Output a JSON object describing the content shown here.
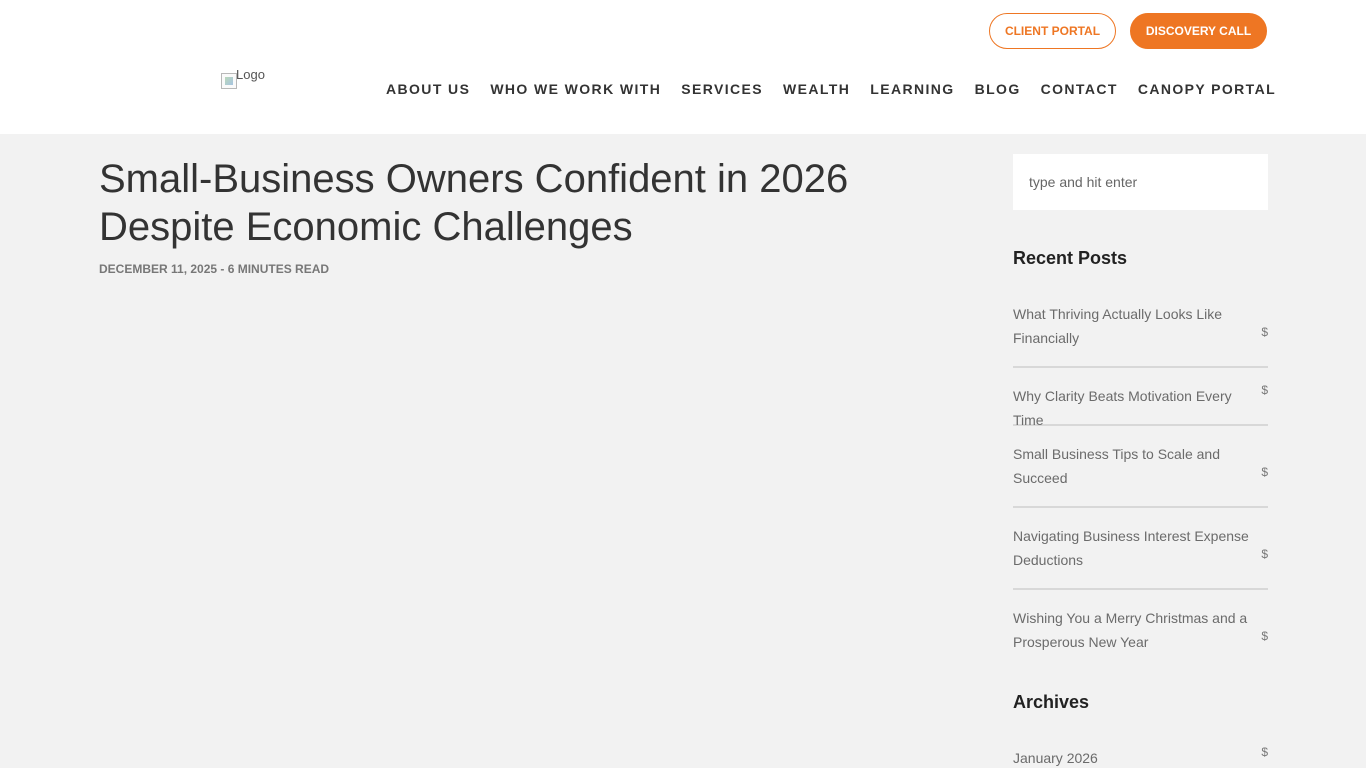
{
  "header": {
    "client_portal": "CLIENT PORTAL",
    "discovery_call": "DISCOVERY CALL",
    "logo_alt": "Logo",
    "nav": [
      "ABOUT US",
      "WHO WE WORK WITH",
      "SERVICES",
      "WEALTH",
      "LEARNING",
      "BLOG",
      "CONTACT",
      "CANOPY PORTAL"
    ]
  },
  "article": {
    "title": "Small-Business Owners Confident in 2026 Despite Economic Challenges",
    "meta": "DECEMBER 11, 2025 - 6 MINUTES READ"
  },
  "sidebar": {
    "search_placeholder": "type and hit enter",
    "recent_title": "Recent Posts",
    "recent_posts": [
      "What Thriving Actually Looks Like Financially",
      "Why Clarity Beats Motivation Every Time",
      "Small Business Tips to Scale and Succeed",
      "Navigating Business Interest Expense Deductions",
      "Wishing You a Merry Christmas and a Prosperous New Year"
    ],
    "dollar": "$",
    "archives_title": "Archives",
    "archives": [
      "January 2026"
    ]
  },
  "colors": {
    "accent": "#ee7623",
    "background": "#f2f2f2"
  }
}
